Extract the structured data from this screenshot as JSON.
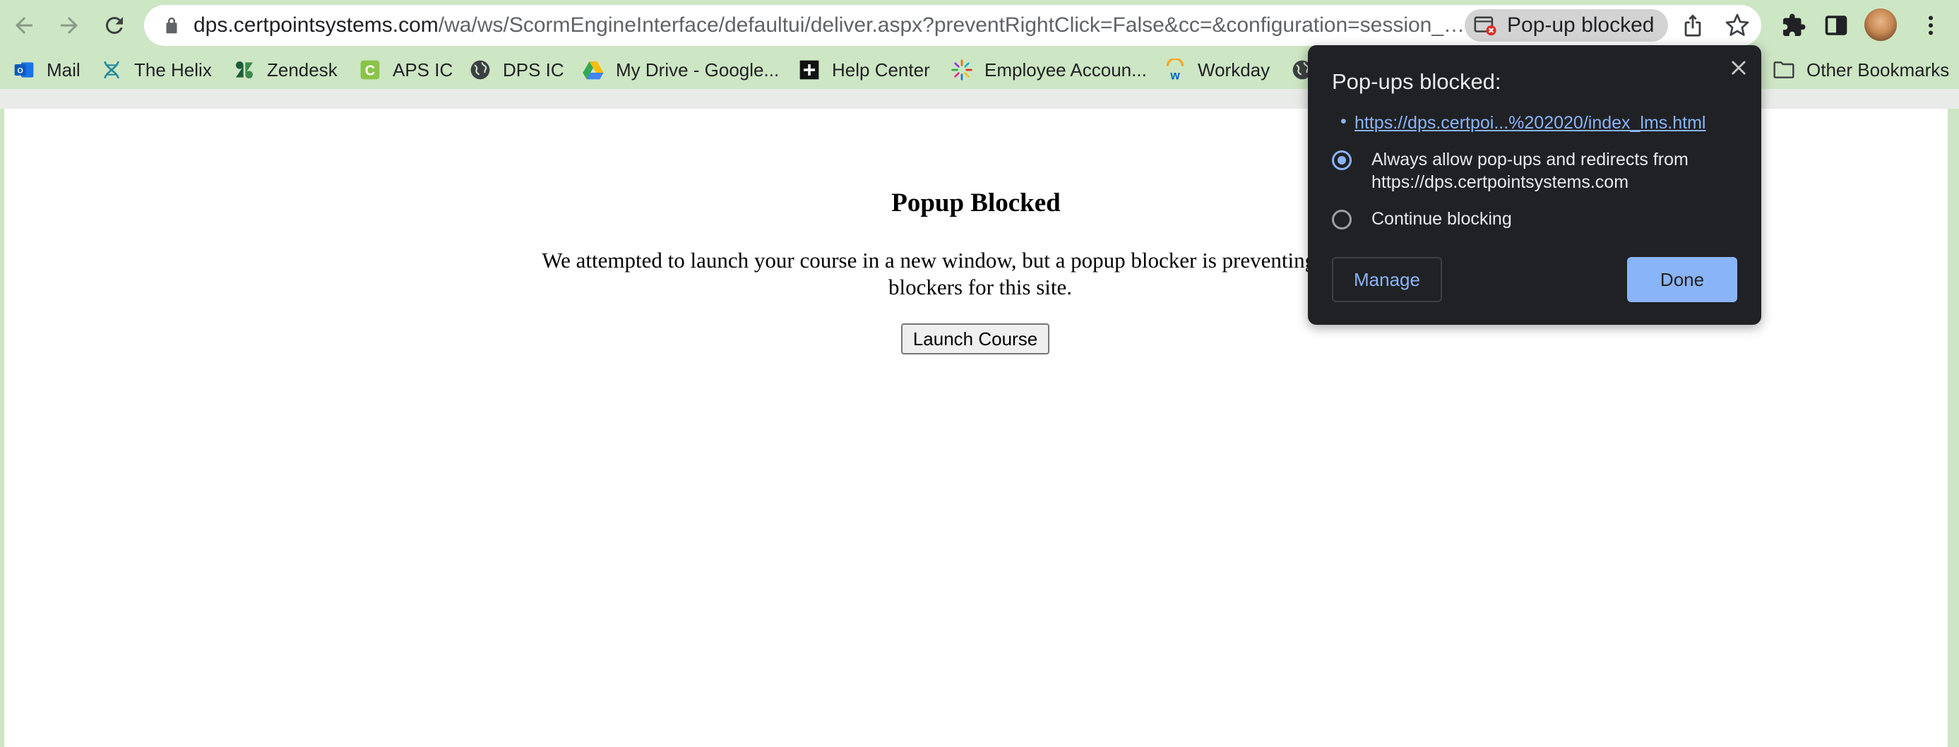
{
  "toolbar": {
    "url_domain": "dps.certpointsystems.com",
    "url_path": "/wa/ws/ScormEngineInterface/defaultui/deliver.aspx?preventRightClick=False&cc=&configuration=session_…",
    "popup_chip_label": "Pop-up blocked"
  },
  "bookmarks": [
    {
      "label": "Mail",
      "icon": "outlook-icon"
    },
    {
      "label": "The Helix",
      "icon": "helix-icon"
    },
    {
      "label": "Zendesk",
      "icon": "zendesk-icon"
    },
    {
      "label": "APS IC",
      "icon": "aps-ic-icon"
    },
    {
      "label": "DPS IC",
      "icon": "globe-icon"
    },
    {
      "label": "My Drive - Google...",
      "icon": "google-drive-icon"
    },
    {
      "label": "Help Center",
      "icon": "help-center-icon"
    },
    {
      "label": "Employee Accoun...",
      "icon": "employee-icon"
    },
    {
      "label": "Workday",
      "icon": "workday-icon"
    },
    {
      "label": "Other Bookmarks",
      "icon": "folder-icon"
    }
  ],
  "page": {
    "heading": "Popup Blocked",
    "message": "We attempted to launch your course in a new window, but a popup blocker is preventing it from ope",
    "message_line2": "blockers for this site.",
    "launch_button": "Launch Course"
  },
  "bubble": {
    "title": "Pop-ups blocked:",
    "bullet": "•",
    "link": "https://dps.certpoi...%202020/index_lms.html",
    "option_allow_line1": "Always allow pop-ups and redirects from",
    "option_allow_line2": "https://dps.certpointsystems.com",
    "option_block": "Continue blocking",
    "manage_label": "Manage",
    "done_label": "Done",
    "selected_option": "allow"
  },
  "colors": {
    "frame": "#cde6c4",
    "bubble_bg": "#202124",
    "accent": "#8ab4f8"
  }
}
